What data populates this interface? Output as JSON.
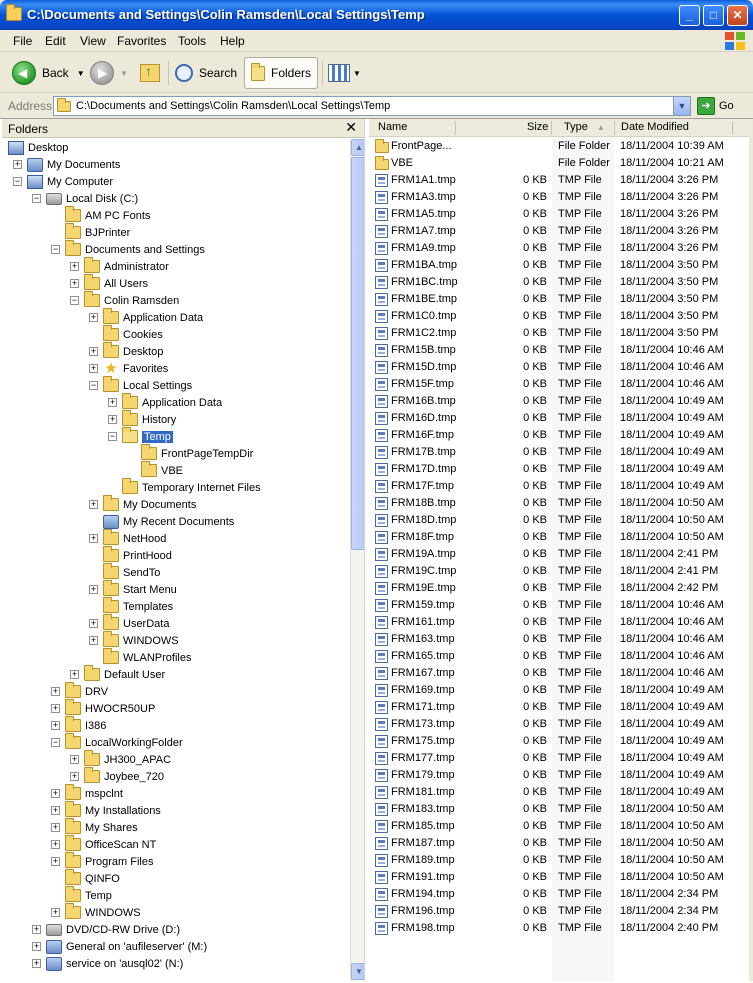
{
  "window": {
    "title": "C:\\Documents and Settings\\Colin Ramsden\\Local Settings\\Temp"
  },
  "menu": [
    "File",
    "Edit",
    "View",
    "Favorites",
    "Tools",
    "Help"
  ],
  "toolbar": {
    "back": "Back",
    "search": "Search",
    "folders": "Folders"
  },
  "address": {
    "label": "Address",
    "value": "C:\\Documents and Settings\\Colin Ramsden\\Local Settings\\Temp",
    "go": "Go"
  },
  "folders_pane": {
    "title": "Folders",
    "close": "✕"
  },
  "tree": [
    {
      "label": "Desktop",
      "level": 0,
      "icon": "desktop",
      "exp": ""
    },
    {
      "label": "My Documents",
      "level": 1,
      "icon": "docs",
      "exp": "+"
    },
    {
      "label": "My Computer",
      "level": 1,
      "icon": "computer",
      "exp": "-"
    },
    {
      "label": "Local Disk (C:)",
      "level": 2,
      "icon": "drive",
      "exp": "-"
    },
    {
      "label": "AM PC Fonts",
      "level": 3,
      "icon": "folder",
      "exp": ""
    },
    {
      "label": "BJPrinter",
      "level": 3,
      "icon": "folder",
      "exp": ""
    },
    {
      "label": "Documents and Settings",
      "level": 3,
      "icon": "folder",
      "exp": "-"
    },
    {
      "label": "Administrator",
      "level": 4,
      "icon": "folder",
      "exp": "+"
    },
    {
      "label": "All Users",
      "level": 4,
      "icon": "folder",
      "exp": "+"
    },
    {
      "label": "Colin Ramsden",
      "level": 4,
      "icon": "folder",
      "exp": "-"
    },
    {
      "label": "Application Data",
      "level": 5,
      "icon": "folder",
      "exp": "+"
    },
    {
      "label": "Cookies",
      "level": 5,
      "icon": "folder",
      "exp": ""
    },
    {
      "label": "Desktop",
      "level": 5,
      "icon": "folder",
      "exp": "+"
    },
    {
      "label": "Favorites",
      "level": 5,
      "icon": "star",
      "exp": "+"
    },
    {
      "label": "Local Settings",
      "level": 5,
      "icon": "folder",
      "exp": "-"
    },
    {
      "label": "Application Data",
      "level": 6,
      "icon": "folder",
      "exp": "+"
    },
    {
      "label": "History",
      "level": 6,
      "icon": "folder",
      "exp": "+"
    },
    {
      "label": "Temp",
      "level": 6,
      "icon": "folder-open",
      "exp": "-",
      "selected": true
    },
    {
      "label": "FrontPageTempDir",
      "level": 7,
      "icon": "folder",
      "exp": ""
    },
    {
      "label": "VBE",
      "level": 7,
      "icon": "folder",
      "exp": ""
    },
    {
      "label": "Temporary Internet Files",
      "level": 6,
      "icon": "folder",
      "exp": ""
    },
    {
      "label": "My Documents",
      "level": 5,
      "icon": "folder",
      "exp": "+"
    },
    {
      "label": "My Recent Documents",
      "level": 5,
      "icon": "docs",
      "exp": ""
    },
    {
      "label": "NetHood",
      "level": 5,
      "icon": "folder",
      "exp": "+"
    },
    {
      "label": "PrintHood",
      "level": 5,
      "icon": "folder",
      "exp": ""
    },
    {
      "label": "SendTo",
      "level": 5,
      "icon": "folder",
      "exp": ""
    },
    {
      "label": "Start Menu",
      "level": 5,
      "icon": "folder",
      "exp": "+"
    },
    {
      "label": "Templates",
      "level": 5,
      "icon": "folder",
      "exp": ""
    },
    {
      "label": "UserData",
      "level": 5,
      "icon": "folder",
      "exp": "+"
    },
    {
      "label": "WINDOWS",
      "level": 5,
      "icon": "folder",
      "exp": "+"
    },
    {
      "label": "WLANProfiles",
      "level": 5,
      "icon": "folder",
      "exp": ""
    },
    {
      "label": "Default User",
      "level": 4,
      "icon": "folder",
      "exp": "+"
    },
    {
      "label": "DRV",
      "level": 3,
      "icon": "folder",
      "exp": "+"
    },
    {
      "label": "HWOCR50UP",
      "level": 3,
      "icon": "folder",
      "exp": "+"
    },
    {
      "label": "I386",
      "level": 3,
      "icon": "folder",
      "exp": "+"
    },
    {
      "label": "LocalWorkingFolder",
      "level": 3,
      "icon": "folder",
      "exp": "-"
    },
    {
      "label": "JH300_APAC",
      "level": 4,
      "icon": "folder",
      "exp": "+"
    },
    {
      "label": "Joybee_720",
      "level": 4,
      "icon": "folder",
      "exp": "+"
    },
    {
      "label": "mspclnt",
      "level": 3,
      "icon": "folder",
      "exp": "+"
    },
    {
      "label": "My Installations",
      "level": 3,
      "icon": "folder",
      "exp": "+"
    },
    {
      "label": "My Shares",
      "level": 3,
      "icon": "folder",
      "exp": "+"
    },
    {
      "label": "OfficeScan NT",
      "level": 3,
      "icon": "folder",
      "exp": "+"
    },
    {
      "label": "Program Files",
      "level": 3,
      "icon": "folder",
      "exp": "+"
    },
    {
      "label": "QINFO",
      "level": 3,
      "icon": "folder",
      "exp": ""
    },
    {
      "label": "Temp",
      "level": 3,
      "icon": "folder",
      "exp": ""
    },
    {
      "label": "WINDOWS",
      "level": 3,
      "icon": "folder",
      "exp": "+"
    },
    {
      "label": "DVD/CD-RW Drive (D:)",
      "level": 2,
      "icon": "drive",
      "exp": "+"
    },
    {
      "label": "General on 'aufileserver' (M:)",
      "level": 2,
      "icon": "net",
      "exp": "+"
    },
    {
      "label": "service on 'ausql02' (N:)",
      "level": 2,
      "icon": "net",
      "exp": "+"
    }
  ],
  "columns": {
    "name": "Name",
    "size": "Size",
    "type": "Type",
    "date": "Date Modified"
  },
  "files": [
    {
      "name": "FrontPage...",
      "size": "",
      "type": "File Folder",
      "date": "18/11/2004 10:39 AM",
      "icon": "folder"
    },
    {
      "name": "VBE",
      "size": "",
      "type": "File Folder",
      "date": "18/11/2004 10:21 AM",
      "icon": "folder"
    },
    {
      "name": "FRM1A1.tmp",
      "size": "0 KB",
      "type": "TMP File",
      "date": "18/11/2004 3:26 PM",
      "icon": "tmp"
    },
    {
      "name": "FRM1A3.tmp",
      "size": "0 KB",
      "type": "TMP File",
      "date": "18/11/2004 3:26 PM",
      "icon": "tmp"
    },
    {
      "name": "FRM1A5.tmp",
      "size": "0 KB",
      "type": "TMP File",
      "date": "18/11/2004 3:26 PM",
      "icon": "tmp"
    },
    {
      "name": "FRM1A7.tmp",
      "size": "0 KB",
      "type": "TMP File",
      "date": "18/11/2004 3:26 PM",
      "icon": "tmp"
    },
    {
      "name": "FRM1A9.tmp",
      "size": "0 KB",
      "type": "TMP File",
      "date": "18/11/2004 3:26 PM",
      "icon": "tmp"
    },
    {
      "name": "FRM1BA.tmp",
      "size": "0 KB",
      "type": "TMP File",
      "date": "18/11/2004 3:50 PM",
      "icon": "tmp"
    },
    {
      "name": "FRM1BC.tmp",
      "size": "0 KB",
      "type": "TMP File",
      "date": "18/11/2004 3:50 PM",
      "icon": "tmp"
    },
    {
      "name": "FRM1BE.tmp",
      "size": "0 KB",
      "type": "TMP File",
      "date": "18/11/2004 3:50 PM",
      "icon": "tmp"
    },
    {
      "name": "FRM1C0.tmp",
      "size": "0 KB",
      "type": "TMP File",
      "date": "18/11/2004 3:50 PM",
      "icon": "tmp"
    },
    {
      "name": "FRM1C2.tmp",
      "size": "0 KB",
      "type": "TMP File",
      "date": "18/11/2004 3:50 PM",
      "icon": "tmp"
    },
    {
      "name": "FRM15B.tmp",
      "size": "0 KB",
      "type": "TMP File",
      "date": "18/11/2004 10:46 AM",
      "icon": "tmp"
    },
    {
      "name": "FRM15D.tmp",
      "size": "0 KB",
      "type": "TMP File",
      "date": "18/11/2004 10:46 AM",
      "icon": "tmp"
    },
    {
      "name": "FRM15F.tmp",
      "size": "0 KB",
      "type": "TMP File",
      "date": "18/11/2004 10:46 AM",
      "icon": "tmp"
    },
    {
      "name": "FRM16B.tmp",
      "size": "0 KB",
      "type": "TMP File",
      "date": "18/11/2004 10:49 AM",
      "icon": "tmp"
    },
    {
      "name": "FRM16D.tmp",
      "size": "0 KB",
      "type": "TMP File",
      "date": "18/11/2004 10:49 AM",
      "icon": "tmp"
    },
    {
      "name": "FRM16F.tmp",
      "size": "0 KB",
      "type": "TMP File",
      "date": "18/11/2004 10:49 AM",
      "icon": "tmp"
    },
    {
      "name": "FRM17B.tmp",
      "size": "0 KB",
      "type": "TMP File",
      "date": "18/11/2004 10:49 AM",
      "icon": "tmp"
    },
    {
      "name": "FRM17D.tmp",
      "size": "0 KB",
      "type": "TMP File",
      "date": "18/11/2004 10:49 AM",
      "icon": "tmp"
    },
    {
      "name": "FRM17F.tmp",
      "size": "0 KB",
      "type": "TMP File",
      "date": "18/11/2004 10:49 AM",
      "icon": "tmp"
    },
    {
      "name": "FRM18B.tmp",
      "size": "0 KB",
      "type": "TMP File",
      "date": "18/11/2004 10:50 AM",
      "icon": "tmp"
    },
    {
      "name": "FRM18D.tmp",
      "size": "0 KB",
      "type": "TMP File",
      "date": "18/11/2004 10:50 AM",
      "icon": "tmp"
    },
    {
      "name": "FRM18F.tmp",
      "size": "0 KB",
      "type": "TMP File",
      "date": "18/11/2004 10:50 AM",
      "icon": "tmp"
    },
    {
      "name": "FRM19A.tmp",
      "size": "0 KB",
      "type": "TMP File",
      "date": "18/11/2004 2:41 PM",
      "icon": "tmp"
    },
    {
      "name": "FRM19C.tmp",
      "size": "0 KB",
      "type": "TMP File",
      "date": "18/11/2004 2:41 PM",
      "icon": "tmp"
    },
    {
      "name": "FRM19E.tmp",
      "size": "0 KB",
      "type": "TMP File",
      "date": "18/11/2004 2:42 PM",
      "icon": "tmp"
    },
    {
      "name": "FRM159.tmp",
      "size": "0 KB",
      "type": "TMP File",
      "date": "18/11/2004 10:46 AM",
      "icon": "tmp"
    },
    {
      "name": "FRM161.tmp",
      "size": "0 KB",
      "type": "TMP File",
      "date": "18/11/2004 10:46 AM",
      "icon": "tmp"
    },
    {
      "name": "FRM163.tmp",
      "size": "0 KB",
      "type": "TMP File",
      "date": "18/11/2004 10:46 AM",
      "icon": "tmp"
    },
    {
      "name": "FRM165.tmp",
      "size": "0 KB",
      "type": "TMP File",
      "date": "18/11/2004 10:46 AM",
      "icon": "tmp"
    },
    {
      "name": "FRM167.tmp",
      "size": "0 KB",
      "type": "TMP File",
      "date": "18/11/2004 10:46 AM",
      "icon": "tmp"
    },
    {
      "name": "FRM169.tmp",
      "size": "0 KB",
      "type": "TMP File",
      "date": "18/11/2004 10:49 AM",
      "icon": "tmp"
    },
    {
      "name": "FRM171.tmp",
      "size": "0 KB",
      "type": "TMP File",
      "date": "18/11/2004 10:49 AM",
      "icon": "tmp"
    },
    {
      "name": "FRM173.tmp",
      "size": "0 KB",
      "type": "TMP File",
      "date": "18/11/2004 10:49 AM",
      "icon": "tmp"
    },
    {
      "name": "FRM175.tmp",
      "size": "0 KB",
      "type": "TMP File",
      "date": "18/11/2004 10:49 AM",
      "icon": "tmp"
    },
    {
      "name": "FRM177.tmp",
      "size": "0 KB",
      "type": "TMP File",
      "date": "18/11/2004 10:49 AM",
      "icon": "tmp"
    },
    {
      "name": "FRM179.tmp",
      "size": "0 KB",
      "type": "TMP File",
      "date": "18/11/2004 10:49 AM",
      "icon": "tmp"
    },
    {
      "name": "FRM181.tmp",
      "size": "0 KB",
      "type": "TMP File",
      "date": "18/11/2004 10:49 AM",
      "icon": "tmp"
    },
    {
      "name": "FRM183.tmp",
      "size": "0 KB",
      "type": "TMP File",
      "date": "18/11/2004 10:50 AM",
      "icon": "tmp"
    },
    {
      "name": "FRM185.tmp",
      "size": "0 KB",
      "type": "TMP File",
      "date": "18/11/2004 10:50 AM",
      "icon": "tmp"
    },
    {
      "name": "FRM187.tmp",
      "size": "0 KB",
      "type": "TMP File",
      "date": "18/11/2004 10:50 AM",
      "icon": "tmp"
    },
    {
      "name": "FRM189.tmp",
      "size": "0 KB",
      "type": "TMP File",
      "date": "18/11/2004 10:50 AM",
      "icon": "tmp"
    },
    {
      "name": "FRM191.tmp",
      "size": "0 KB",
      "type": "TMP File",
      "date": "18/11/2004 10:50 AM",
      "icon": "tmp"
    },
    {
      "name": "FRM194.tmp",
      "size": "0 KB",
      "type": "TMP File",
      "date": "18/11/2004 2:34 PM",
      "icon": "tmp"
    },
    {
      "name": "FRM196.tmp",
      "size": "0 KB",
      "type": "TMP File",
      "date": "18/11/2004 2:34 PM",
      "icon": "tmp"
    },
    {
      "name": "FRM198.tmp",
      "size": "0 KB",
      "type": "TMP File",
      "date": "18/11/2004 2:40 PM",
      "icon": "tmp"
    }
  ]
}
